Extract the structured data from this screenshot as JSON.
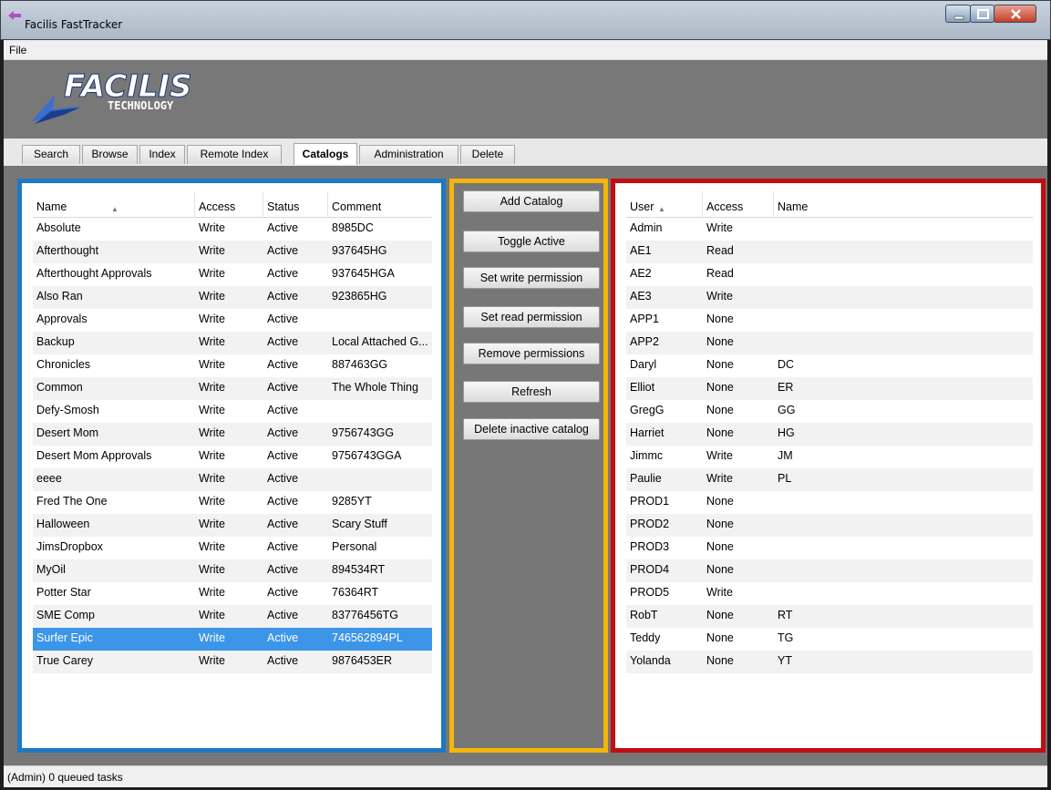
{
  "window": {
    "title": "Facilis FastTracker"
  },
  "menu": {
    "file_label": "File"
  },
  "banner": {
    "logo_line1": "FACILIS",
    "logo_line2": "TECHNOLOGY"
  },
  "tabs": [
    {
      "label": "Search"
    },
    {
      "label": "Browse"
    },
    {
      "label": "Index"
    },
    {
      "label": "Remote Index"
    },
    {
      "label": "Catalogs",
      "active": true
    },
    {
      "label": "Administration"
    },
    {
      "label": "Delete"
    }
  ],
  "catalogs": {
    "columns": [
      "Name",
      "Access",
      "Status",
      "Comment"
    ],
    "sort_column": "Name",
    "rows": [
      {
        "name": "Absolute",
        "access": "Write",
        "status": "Active",
        "comment": "8985DC"
      },
      {
        "name": "Afterthought",
        "access": "Write",
        "status": "Active",
        "comment": "937645HG"
      },
      {
        "name": "Afterthought Approvals",
        "access": "Write",
        "status": "Active",
        "comment": "937645HGA"
      },
      {
        "name": "Also Ran",
        "access": "Write",
        "status": "Active",
        "comment": "923865HG"
      },
      {
        "name": "Approvals",
        "access": "Write",
        "status": "Active",
        "comment": ""
      },
      {
        "name": "Backup",
        "access": "Write",
        "status": "Active",
        "comment": "Local Attached G..."
      },
      {
        "name": "Chronicles",
        "access": "Write",
        "status": "Active",
        "comment": "887463GG"
      },
      {
        "name": "Common",
        "access": "Write",
        "status": "Active",
        "comment": "The Whole Thing"
      },
      {
        "name": "Defy-Smosh",
        "access": "Write",
        "status": "Active",
        "comment": ""
      },
      {
        "name": "Desert Mom",
        "access": "Write",
        "status": "Active",
        "comment": "9756743GG"
      },
      {
        "name": "Desert Mom Approvals",
        "access": "Write",
        "status": "Active",
        "comment": "9756743GGA"
      },
      {
        "name": "eeee",
        "access": "Write",
        "status": "Active",
        "comment": ""
      },
      {
        "name": "Fred The One",
        "access": "Write",
        "status": "Active",
        "comment": "9285YT"
      },
      {
        "name": "Halloween",
        "access": "Write",
        "status": "Active",
        "comment": "Scary Stuff"
      },
      {
        "name": "JimsDropbox",
        "access": "Write",
        "status": "Active",
        "comment": "Personal"
      },
      {
        "name": "MyOil",
        "access": "Write",
        "status": "Active",
        "comment": "894534RT"
      },
      {
        "name": "Potter Star",
        "access": "Write",
        "status": "Active",
        "comment": "76364RT"
      },
      {
        "name": "SME Comp",
        "access": "Write",
        "status": "Active",
        "comment": "83776456TG"
      },
      {
        "name": "Surfer Epic",
        "access": "Write",
        "status": "Active",
        "comment": "746562894PL",
        "selected": true
      },
      {
        "name": "True Carey",
        "access": "Write",
        "status": "Active",
        "comment": "9876453ER"
      }
    ]
  },
  "actions": [
    {
      "label": "Add Catalog"
    },
    {
      "label": "Toggle Active"
    },
    {
      "label": "Set write permission"
    },
    {
      "label": "Set read permission"
    },
    {
      "label": "Remove permissions"
    },
    {
      "label": "Refresh"
    },
    {
      "label": "Delete inactive catalog"
    }
  ],
  "users": {
    "columns": [
      "User",
      "Access",
      "Name"
    ],
    "sort_column": "User",
    "rows": [
      {
        "user": "Admin",
        "access": "Write",
        "name": ""
      },
      {
        "user": "AE1",
        "access": "Read",
        "name": ""
      },
      {
        "user": "AE2",
        "access": "Read",
        "name": ""
      },
      {
        "user": "AE3",
        "access": "Write",
        "name": ""
      },
      {
        "user": "APP1",
        "access": "None",
        "name": ""
      },
      {
        "user": "APP2",
        "access": "None",
        "name": ""
      },
      {
        "user": "Daryl",
        "access": "None",
        "name": "DC"
      },
      {
        "user": "Elliot",
        "access": "None",
        "name": "ER"
      },
      {
        "user": "GregG",
        "access": "None",
        "name": "GG"
      },
      {
        "user": "Harriet",
        "access": "None",
        "name": "HG"
      },
      {
        "user": "Jimmc",
        "access": "Write",
        "name": "JM"
      },
      {
        "user": "Paulie",
        "access": "Write",
        "name": "PL"
      },
      {
        "user": "PROD1",
        "access": "None",
        "name": ""
      },
      {
        "user": "PROD2",
        "access": "None",
        "name": ""
      },
      {
        "user": "PROD3",
        "access": "None",
        "name": ""
      },
      {
        "user": "PROD4",
        "access": "None",
        "name": ""
      },
      {
        "user": "PROD5",
        "access": "Write",
        "name": ""
      },
      {
        "user": "RobT",
        "access": "None",
        "name": "RT"
      },
      {
        "user": "Teddy",
        "access": "None",
        "name": "TG"
      },
      {
        "user": "Yolanda",
        "access": "None",
        "name": "YT"
      }
    ]
  },
  "status": {
    "text": "(Admin) 0 queued tasks"
  },
  "colors": {
    "left_frame": "#1e78c4",
    "middle_frame": "#f5b50a",
    "right_frame": "#c10f12",
    "selection": "#3d95e8"
  }
}
